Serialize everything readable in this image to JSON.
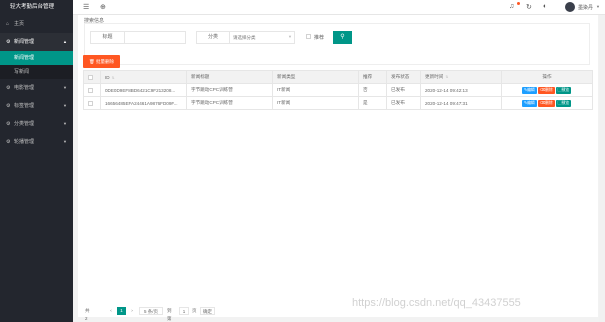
{
  "sidebar": {
    "title": "轻大考勤后台管理",
    "items": [
      {
        "label": "主页",
        "icon": "home-icon"
      },
      {
        "label": "新闻管理",
        "icon": "gear-icon",
        "expanded": true,
        "children": [
          {
            "label": "新闻管理",
            "selected": true
          },
          {
            "label": "写新闻",
            "selected": false
          }
        ]
      },
      {
        "label": "电影管理",
        "icon": "gear-icon"
      },
      {
        "label": "标签管理",
        "icon": "gear-icon"
      },
      {
        "label": "分类管理",
        "icon": "gear-icon"
      },
      {
        "label": "轮播管理",
        "icon": "gear-icon"
      }
    ]
  },
  "header": {
    "user_name": "墨染丹"
  },
  "search": {
    "section_title": "搜索信息",
    "title_label": "标题",
    "title_placeholder": "",
    "category_label": "分类",
    "category_placeholder": "请选择分类",
    "recommend_label": "推荐"
  },
  "toolbar": {
    "batch_delete_label": "批量删除"
  },
  "table": {
    "columns": [
      "ID",
      "新闻标题",
      "新闻类型",
      "推荐",
      "发布状态",
      "更新时间",
      "操作"
    ],
    "rows": [
      {
        "id": "0DE0D9EF8BD6421C9F213208...",
        "title": "字节跳动CPC训练营",
        "type": "IT新闻",
        "recommend": "否",
        "status": "已发布",
        "updated": "2020-12-14 09:42:13"
      },
      {
        "id": "16656485EFA24461A9876FD09F...",
        "title": "字节跳动CPC训练营",
        "type": "IT新闻",
        "recommend": "是",
        "status": "已发布",
        "updated": "2020-12-14 09:47:31"
      }
    ],
    "actions": {
      "edit": "编辑",
      "delete": "删除",
      "view": "预览"
    }
  },
  "pagination": {
    "total_text": "共 2 条",
    "prev": "‹",
    "current": "1",
    "next": "›",
    "page_size": "5 条/页",
    "goto_label": "到第",
    "goto_value": "1",
    "page_unit": "页",
    "confirm": "确定"
  },
  "watermark": "https://blog.csdn.net/qq_43437555",
  "colors": {
    "accent": "#009688",
    "danger": "#ff5722",
    "primary": "#1e9fff",
    "sidebar": "#23262e"
  }
}
